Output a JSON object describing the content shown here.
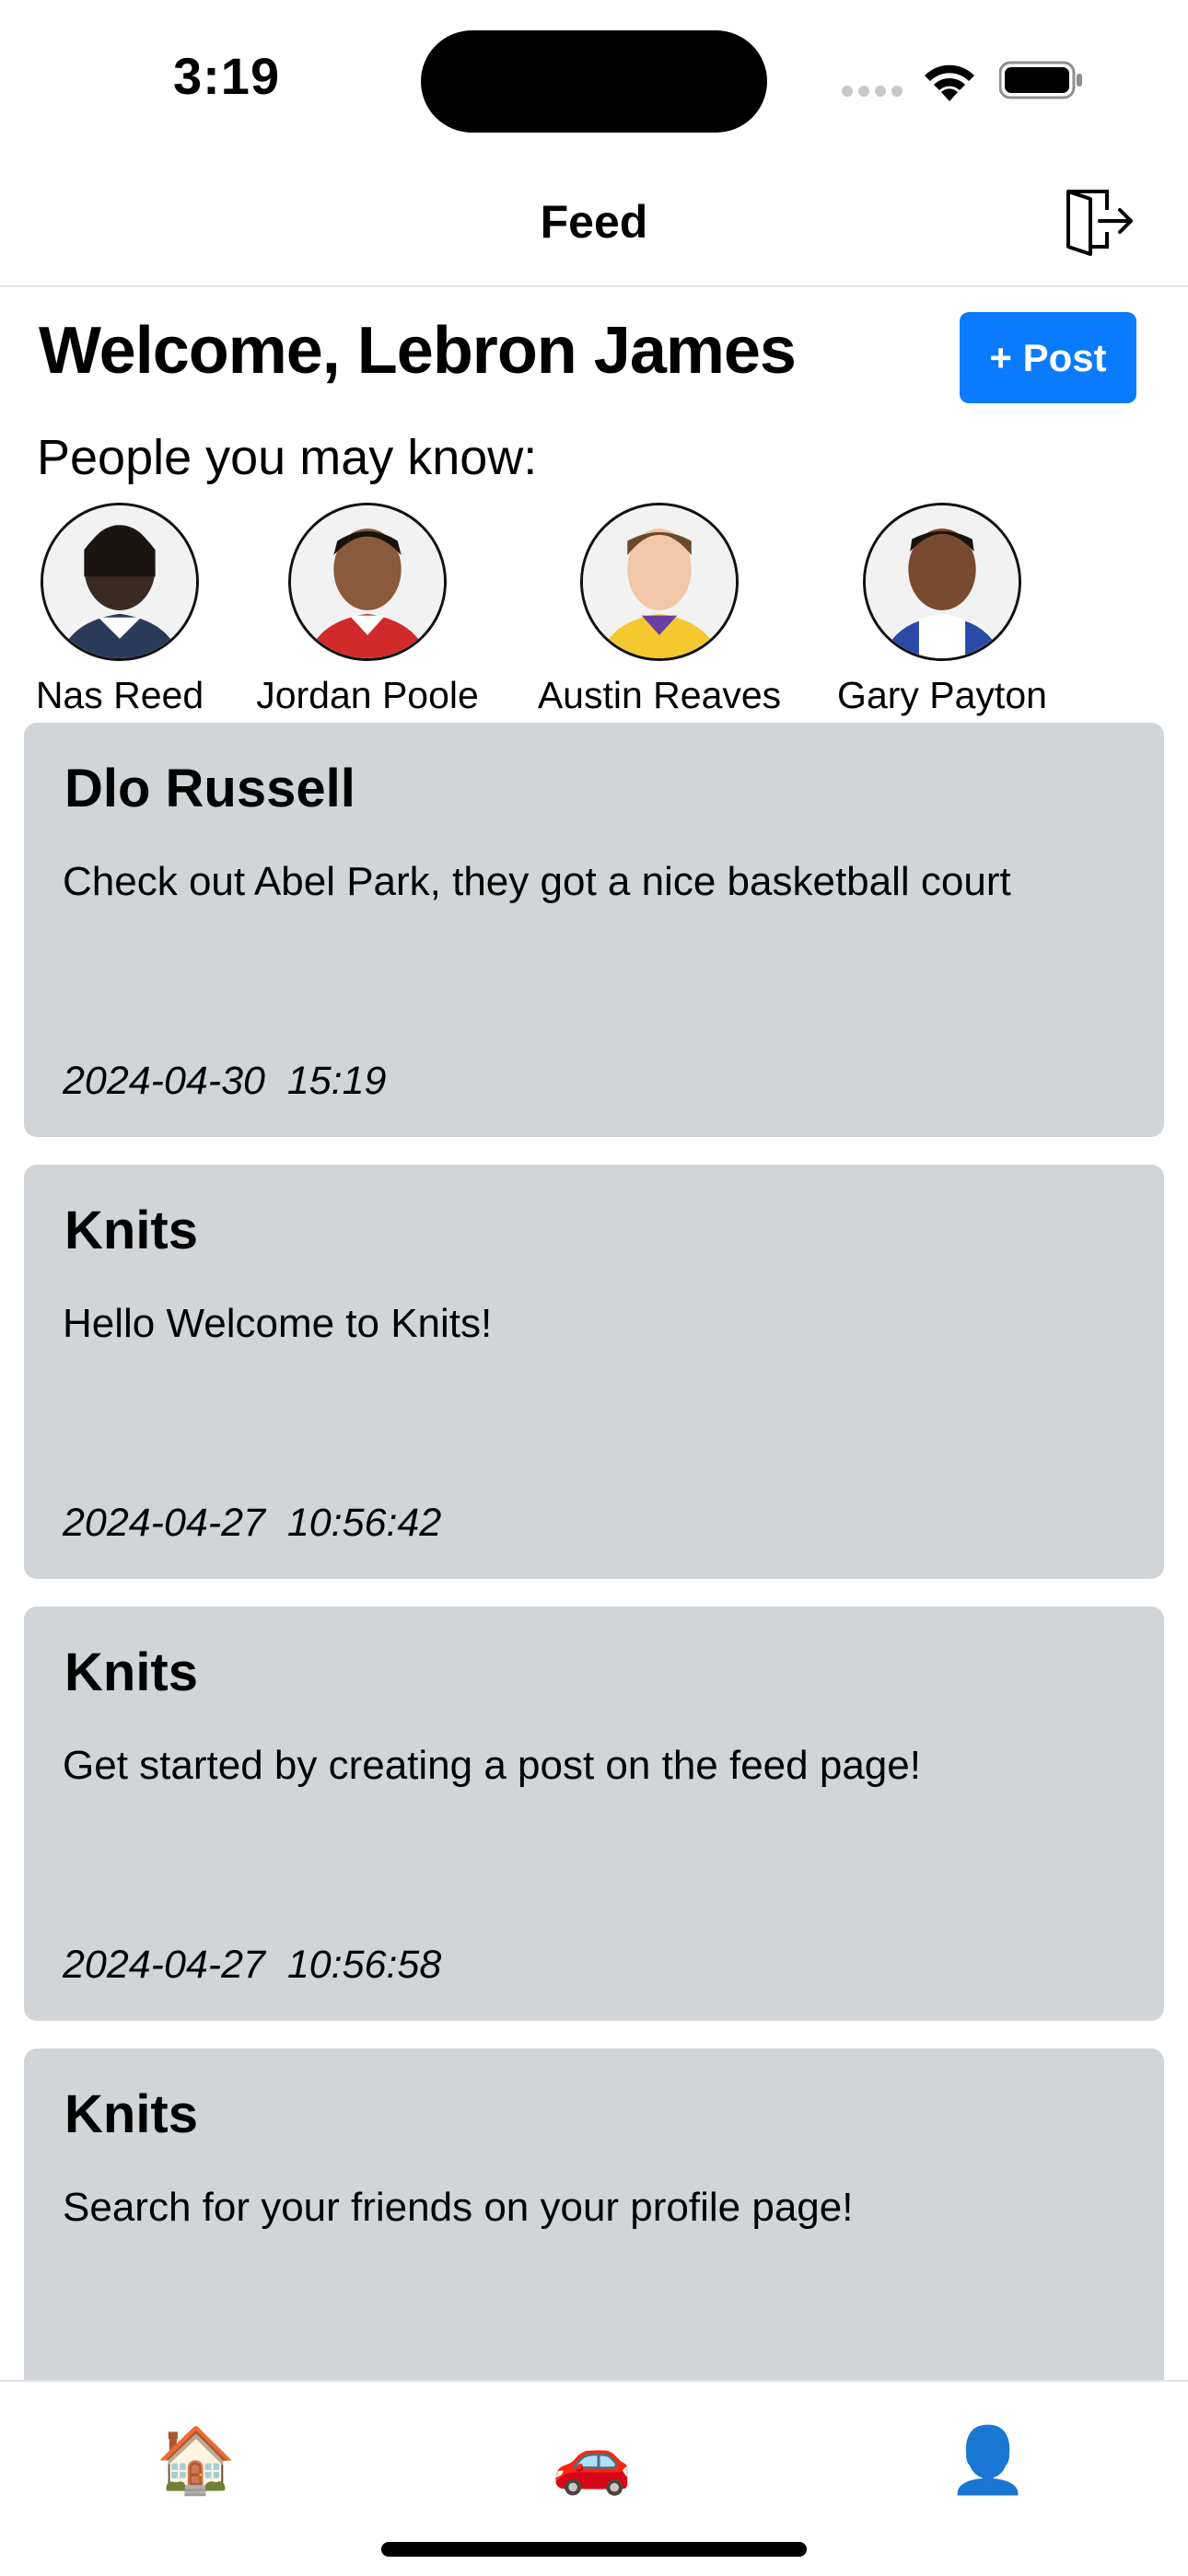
{
  "status": {
    "time": "3:19"
  },
  "nav": {
    "title": "Feed"
  },
  "welcome": {
    "text": "Welcome, Lebron James"
  },
  "post_button": {
    "label": "+ Post"
  },
  "people": {
    "label": "People you may know:",
    "items": [
      {
        "name": "Nas Reed"
      },
      {
        "name": "Jordan Poole"
      },
      {
        "name": "Austin Reaves"
      },
      {
        "name": "Gary Payton"
      }
    ]
  },
  "posts": [
    {
      "author": "Dlo Russell",
      "body": "Check out Abel Park, they got a nice basketball court",
      "date": "2024-04-30  15:19"
    },
    {
      "author": "Knits",
      "body": "Hello Welcome to Knits!",
      "date": "2024-04-27  10:56:42"
    },
    {
      "author": "Knits",
      "body": "Get started by creating a post on the feed page!",
      "date": "2024-04-27  10:56:58"
    },
    {
      "author": "Knits",
      "body": "Search for your friends on your profile page!",
      "date": ""
    }
  ],
  "tabs": [
    {
      "icon": "🏠",
      "name": "home-icon"
    },
    {
      "icon": "🚗",
      "name": "car-icon"
    },
    {
      "icon": "👤",
      "name": "profile-icon"
    }
  ],
  "colors": {
    "accent": "#0a7aff",
    "card_bg": "#d1d5d8"
  }
}
